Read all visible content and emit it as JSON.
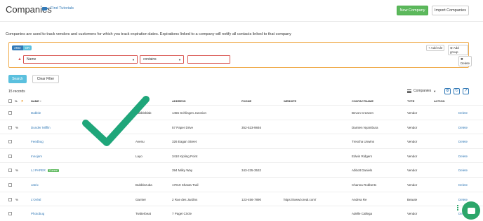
{
  "header": {
    "title": "Companies",
    "tutorials_label": "Find Tutorials",
    "new_button": "New Company",
    "import_button": "Import Companies"
  },
  "description": "Companies are used to track vendors and customers for which you track expiration dates. Expirations linked to a company will notify all contacts linked to that company",
  "filter": {
    "and_label": "AND",
    "or_label": "OR",
    "add_rule": "Add rule",
    "add_group": "Add group",
    "field_value": "Name",
    "operator_value": "contains",
    "value": "",
    "delete_label": "Delete"
  },
  "actions": {
    "search": "Search",
    "clear": "Clear Filter"
  },
  "records_label": "15 records",
  "view_label": "Companies",
  "table": {
    "headers": {
      "name": "NAME",
      "address": "ADDRESS",
      "phone": "PHONE",
      "website": "WEBSITE",
      "contact": "CONTACTNAME",
      "type": "TYPE",
      "action": "ACTION"
    },
    "rows": [
      {
        "name": "Dabble",
        "badge": "",
        "alias": "Babbleblab",
        "address": "1455 Schlingen Junction",
        "phone": "",
        "website": "",
        "contact": "Bevon Creaven",
        "type": "Vendor",
        "action": "Delete"
      },
      {
        "name": "Dunder Mifflin",
        "badge": "",
        "alias": "",
        "address": "57 Paper Drive",
        "phone": "352-523-9846",
        "website": "",
        "contact": "Damien Nyambura",
        "type": "Vendor",
        "action": "Delete"
      },
      {
        "name": "Feedbug",
        "badge": "",
        "alias": "Avenu",
        "address": "326 Eagan Street",
        "phone": "",
        "website": "",
        "contact": "Trescha Unwins",
        "type": "Vendor",
        "action": "Delete"
      },
      {
        "name": "Innojam",
        "badge": "",
        "alias": "Layo",
        "address": "3410 Kipling Point",
        "phone": "",
        "website": "",
        "contact": "Edwin Ridgers",
        "type": "Vendor",
        "action": "Delete"
      },
      {
        "name": "LJ PAPER",
        "badge": "Current",
        "alias": "",
        "address": "394 Milky Way",
        "phone": "343-235-3532",
        "website": "",
        "contact": "Abbott Daniels",
        "type": "Vendor",
        "action": "Delete"
      },
      {
        "name": "Jatrix",
        "badge": "",
        "alias": "Bubblezuba",
        "address": "17019 Shasta Trail",
        "phone": "",
        "website": "",
        "contact": "Channa Robberts",
        "type": "Vendor",
        "action": "Delete"
      },
      {
        "name": "L'Oréal",
        "badge": "",
        "alias": "Garnier",
        "address": "2 Rue des Jardins",
        "phone": "123-456-7890",
        "website": "https://www.loreal.com/",
        "contact": "Andrea Re",
        "type": "Beaute",
        "action": "Delete"
      },
      {
        "name": "Photobug",
        "badge": "",
        "alias": "Twitterbeat",
        "address": "7 Pagei Circle",
        "phone": "",
        "website": "",
        "contact": "Adelle Callega",
        "type": "Vendor",
        "action": "Delete"
      }
    ]
  },
  "icons": {
    "camera": "video-camera-icon",
    "checkmark": "checkmark-icon",
    "chat": "chat-bubble-icon"
  },
  "colors": {
    "primary": "#337ab7",
    "success": "#5cb85c",
    "info": "#5bc0de",
    "warning": "#f0ad4e",
    "danger": "#d9534f",
    "checkmark": "#1fa67a"
  }
}
